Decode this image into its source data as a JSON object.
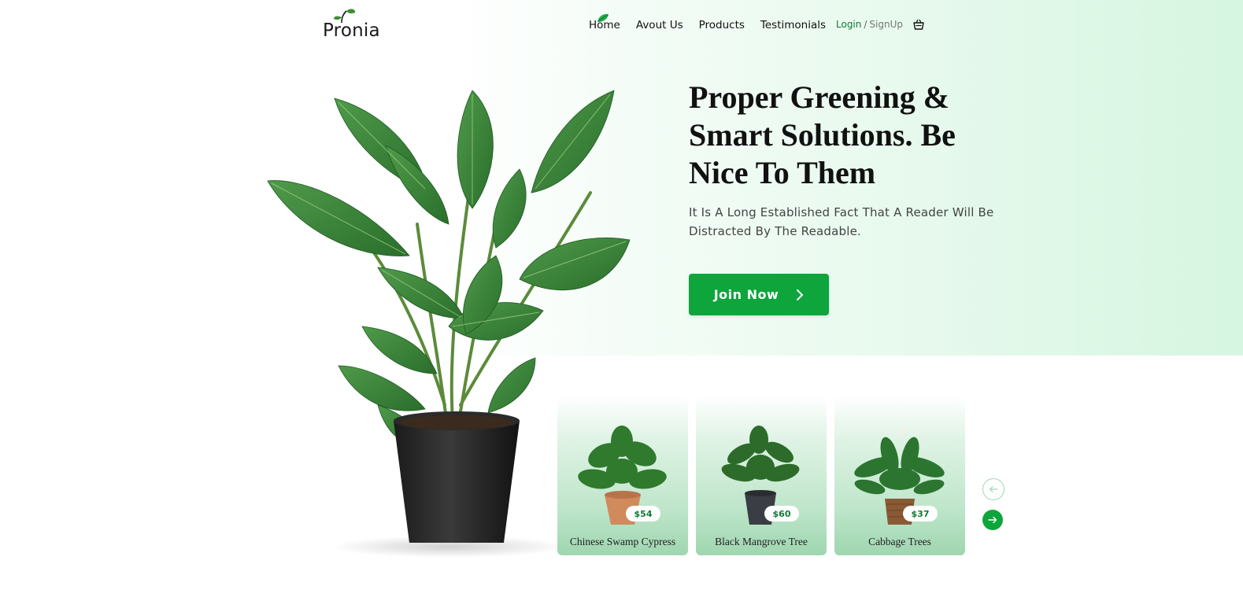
{
  "brand": {
    "logo_text": "Pronia"
  },
  "nav": {
    "items": [
      {
        "label": "Home",
        "active": true
      },
      {
        "label": "Avout Us"
      },
      {
        "label": "Products"
      },
      {
        "label": "Testimonials"
      }
    ],
    "login_label": "Login",
    "separator": "/",
    "signup_label": "SignUp",
    "cart_icon": "basket-icon"
  },
  "hero": {
    "title": "Proper Greening & Smart Solutions. Be Nice To Them",
    "subtitle": "It Is A Long Established Fact That A Reader Will Be Distracted By The Readable.",
    "cta_label": "Join Now"
  },
  "products": [
    {
      "name": "Chinese Swamp Cypress",
      "price": "$54",
      "pot": "copper"
    },
    {
      "name": "Black Mangrove Tree",
      "price": "$60",
      "pot": "black"
    },
    {
      "name": "Cabbage Trees",
      "price": "$37",
      "pot": "basket"
    }
  ],
  "colors": {
    "accent": "#0ea53c",
    "accent_dark": "#0e7a34",
    "hero_gradient_end": "#d6f6e1",
    "card_gradient_end": "#9fd6b0"
  }
}
